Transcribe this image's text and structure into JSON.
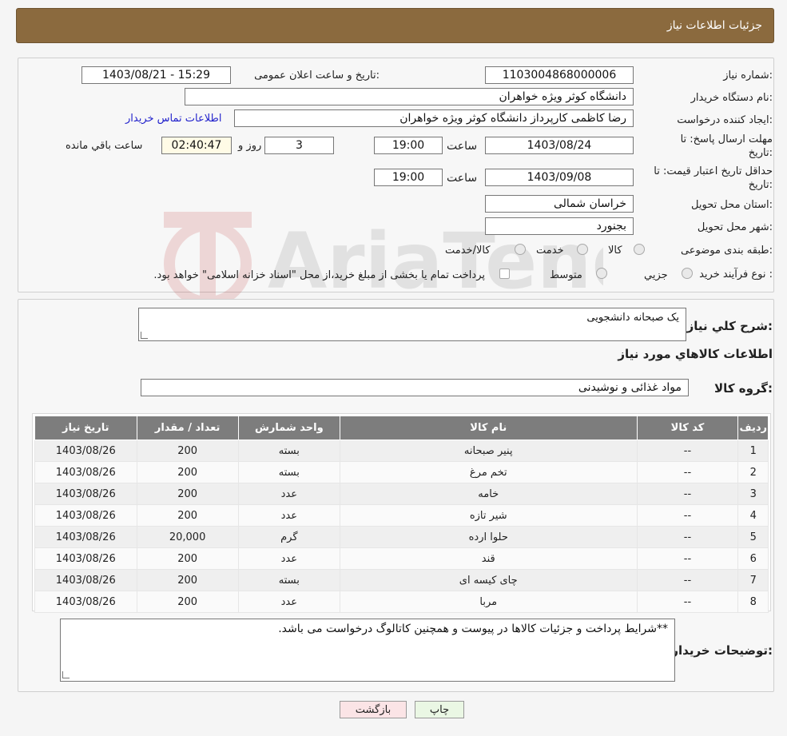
{
  "header": {
    "title": "جزئیات اطلاعات نیاز"
  },
  "form": {
    "need_number_label": "شماره نیاز:",
    "need_number": "1103004868000006",
    "announce_label": "تاریخ و ساعت اعلان عمومی:",
    "announce_value": "1403/08/21 - 15:29",
    "buyer_org_label": "نام دستگاه خریدار:",
    "buyer_org": "دانشگاه کوثر ویژه خواهران",
    "creator_label": "ایجاد کننده درخواست:",
    "creator": "رضا کاظمی کارپرداز دانشگاه کوثر ویژه خواهران",
    "contact_link": "اطلاعات تماس خریدار",
    "deadline_label": "مهلت ارسال پاسخ: تا تاریخ:",
    "deadline_date": "1403/08/24",
    "time_label": "ساعت",
    "deadline_time": "19:00",
    "days": "3",
    "days_label": "روز و",
    "remaining_time": "02:40:47",
    "remaining_label": "ساعت باقي مانده",
    "validity_label": "حداقل تاریخ اعتبار قیمت: تا تاریخ:",
    "validity_date": "1403/09/08",
    "validity_time": "19:00",
    "province_label": "استان محل تحویل:",
    "province": "خراسان شمالی",
    "city_label": "شهر محل تحویل:",
    "city": "بجنورد",
    "category_label": "طبقه بندی موضوعی:",
    "category_options": [
      "کالا",
      "خدمت",
      "کالا/خدمت"
    ],
    "process_label": "نوع فرآیند خرید :",
    "process_options": [
      "جزیي",
      "متوسط"
    ],
    "payment_note": "پرداخت تمام یا بخشی از مبلغ خرید،از محل \"اسناد خزانه اسلامی\" خواهد بود."
  },
  "details": {
    "summary_label": "شرح کلي نیاز:",
    "summary": "یک صبحانه دانشجویی",
    "goods_info_title": "اطلاعات کالاهاي مورد نیاز",
    "goods_group_label": "گروه کالا:",
    "goods_group": "مواد غذائی و نوشیدنی"
  },
  "table": {
    "headers": [
      "ردیف",
      "کد کالا",
      "نام کالا",
      "واحد شمارش",
      "تعداد / مقدار",
      "تاریخ نیاز"
    ],
    "rows": [
      [
        "1",
        "--",
        "پنیر صبحانه",
        "بسته",
        "200",
        "1403/08/26"
      ],
      [
        "2",
        "--",
        "تخم مرغ",
        "بسته",
        "200",
        "1403/08/26"
      ],
      [
        "3",
        "--",
        "خامه",
        "عدد",
        "200",
        "1403/08/26"
      ],
      [
        "4",
        "--",
        "شیر تازه",
        "عدد",
        "200",
        "1403/08/26"
      ],
      [
        "5",
        "--",
        "حلوا ارده",
        "گرم",
        "20,000",
        "1403/08/26"
      ],
      [
        "6",
        "--",
        "قند",
        "عدد",
        "200",
        "1403/08/26"
      ],
      [
        "7",
        "--",
        "چای کیسه ای",
        "بسته",
        "200",
        "1403/08/26"
      ],
      [
        "8",
        "--",
        "مربا",
        "عدد",
        "200",
        "1403/08/26"
      ]
    ]
  },
  "notes": {
    "label": "توضیحات خریدار:",
    "text": "**شرایط پرداخت و جزئیات  کالاها در پیوست و همچنین کاتالوگ درخواست می باشد."
  },
  "buttons": {
    "print": "چاپ",
    "back": "بازگشت"
  },
  "watermark": {
    "brand": "AriaTender.neT"
  },
  "colors": {
    "header": "#8b6a3e",
    "table_header": "#7d7d7d",
    "link": "#2222cc"
  }
}
